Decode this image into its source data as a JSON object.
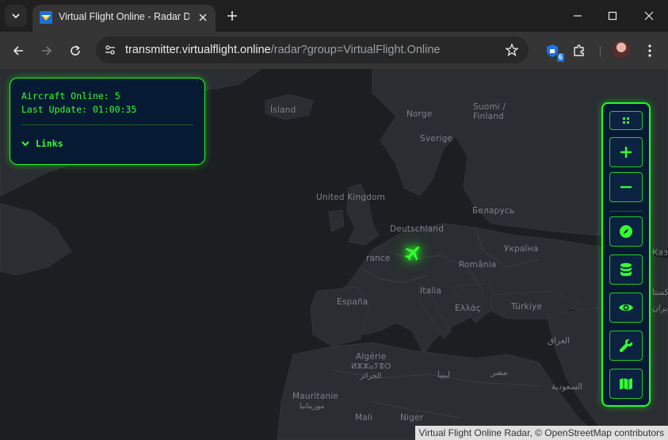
{
  "browser": {
    "tab_title": "Virtual Flight Online - Radar Display",
    "url_host": "transmitter.virtualflight.online",
    "url_path": "/radar?group=VirtualFlight.Online",
    "extension_badge": "6"
  },
  "info_panel": {
    "aircraft_online": "Aircraft Online: 5",
    "last_update": "Last Update: 01:00:35",
    "links_label": "Links"
  },
  "map": {
    "labels": {
      "island": "Ísland",
      "norge": "Norge",
      "suomi": "Suomi /",
      "finland": "Finland",
      "sverige": "Sverige",
      "uk": "United Kingdom",
      "belarus": "Беларусь",
      "deutschland": "Deutschland",
      "france": "rance",
      "ukraine": "Україна",
      "romania": "România",
      "espana": "España",
      "italia": "Italia",
      "ellas": "Ελλάς",
      "turkiye": "Türkiye",
      "kaz": "Каза",
      "iraq": "العراق",
      "pakistan": "کستا",
      "iran": "ایران",
      "algerie": "Algérie",
      "algerie_tif": "ⵍⵣⵣⴰⵢⴻⵔ",
      "algerie_ar": "الجزائر",
      "libya": "ليبيا",
      "misr": "مصر",
      "saudi": "السعودية",
      "mauritanie": "Mauritanie",
      "mauritanie_ar": "موريتانيا",
      "mali": "Mali",
      "niger": "Niger"
    },
    "attribution": "Virtual Flight Online Radar, © OpenStreetMap contributors"
  },
  "controls": {
    "buttons": [
      "grid",
      "zoom-in",
      "zoom-out",
      "compass",
      "database",
      "eye",
      "wrench",
      "map"
    ]
  },
  "colors": {
    "accent": "#22ff22",
    "panel_bg": "#071a33"
  }
}
